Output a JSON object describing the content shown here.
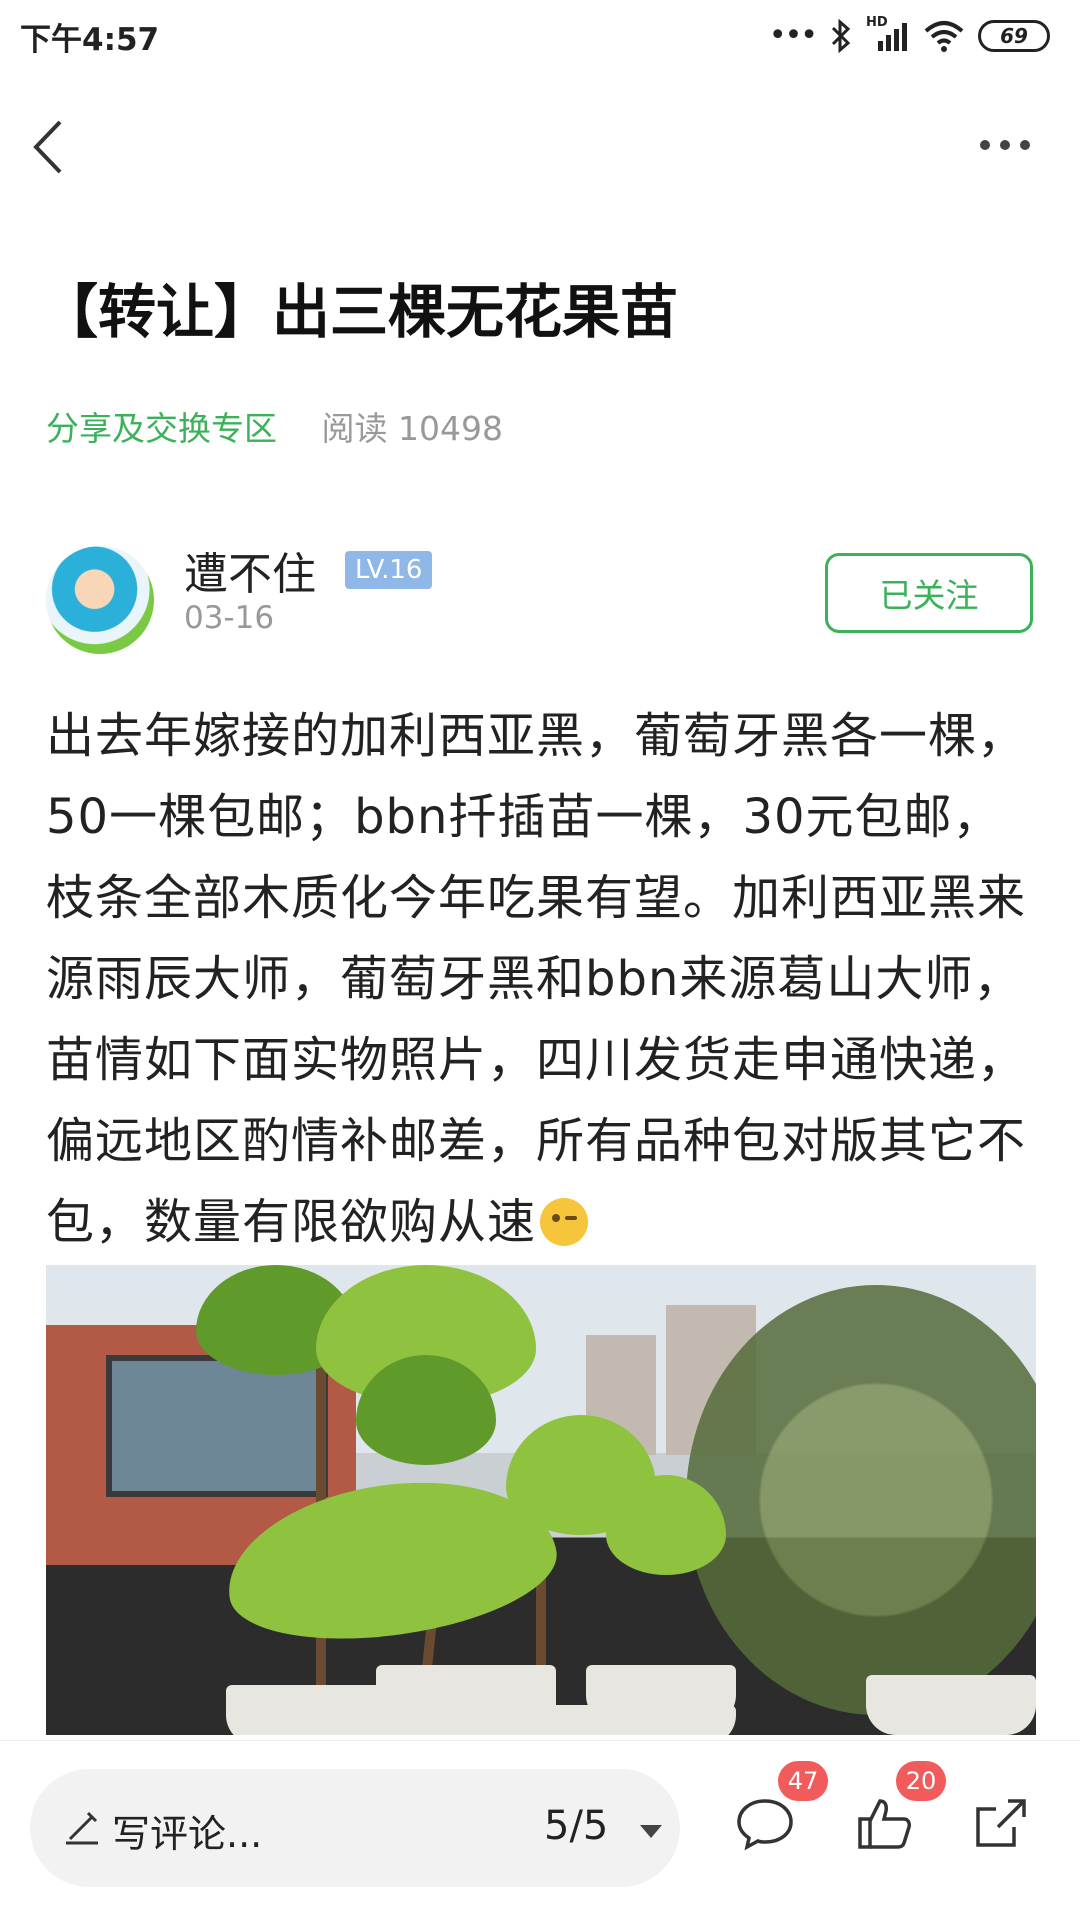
{
  "status_bar": {
    "time": "下午4:57",
    "signal_label": "HD",
    "battery": "69"
  },
  "nav": {
    "back_icon": "chevron-left-icon",
    "more_icon": "more-horizontal-icon"
  },
  "post": {
    "title": "【转让】出三棵无花果苗",
    "category": "分享及交换专区",
    "reads": "阅读 10498",
    "author": {
      "name": "遭不住",
      "level": "LV.16",
      "date": "03-16",
      "follow_label": "已关注"
    },
    "body": "出去年嫁接的加利西亚黑，葡萄牙黑各一棵，50一棵包邮；bbn扦插苗一棵，30元包邮，枝条全部木质化今年吃果有望。加利西亚黑来源雨辰大师，葡萄牙黑和bbn来源葛山大师，苗情如下面实物照片，四川发货走申通快递，偏远地区酌情补邮差，所有品种包对版其它不包，数量有限欲购从速"
  },
  "bottom_bar": {
    "comment_placeholder": "写评论...",
    "page_indicator": "5/5",
    "comment_count": "47",
    "like_count": "20"
  },
  "colors": {
    "accent_green": "#3bb25a",
    "badge_red": "#f15b5b",
    "level_blue": "#8fb7e8"
  }
}
